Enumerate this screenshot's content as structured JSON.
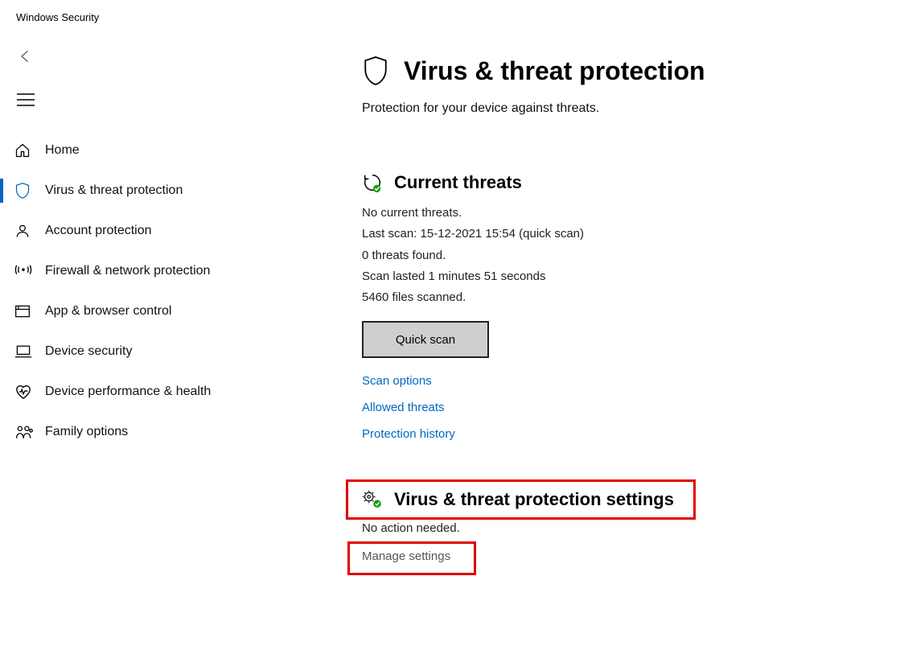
{
  "app_title": "Windows Security",
  "sidebar": {
    "items": [
      {
        "label": "Home"
      },
      {
        "label": "Virus & threat protection"
      },
      {
        "label": "Account protection"
      },
      {
        "label": "Firewall & network protection"
      },
      {
        "label": "App & browser control"
      },
      {
        "label": "Device security"
      },
      {
        "label": "Device performance & health"
      },
      {
        "label": "Family options"
      }
    ]
  },
  "page": {
    "title": "Virus & threat protection",
    "subtitle": "Protection for your device against threats."
  },
  "current_threats": {
    "heading": "Current threats",
    "no_threats": "No current threats.",
    "last_scan": "Last scan: 15-12-2021 15:54 (quick scan)",
    "threats_found": "0 threats found.",
    "scan_duration": "Scan lasted 1 minutes 51 seconds",
    "files_scanned": "5460 files scanned.",
    "quick_scan_btn": "Quick scan",
    "links": {
      "scan_options": "Scan options",
      "allowed_threats": "Allowed threats",
      "protection_history": "Protection history"
    }
  },
  "vt_settings": {
    "heading": "Virus & threat protection settings",
    "status": "No action needed.",
    "manage": "Manage settings"
  }
}
